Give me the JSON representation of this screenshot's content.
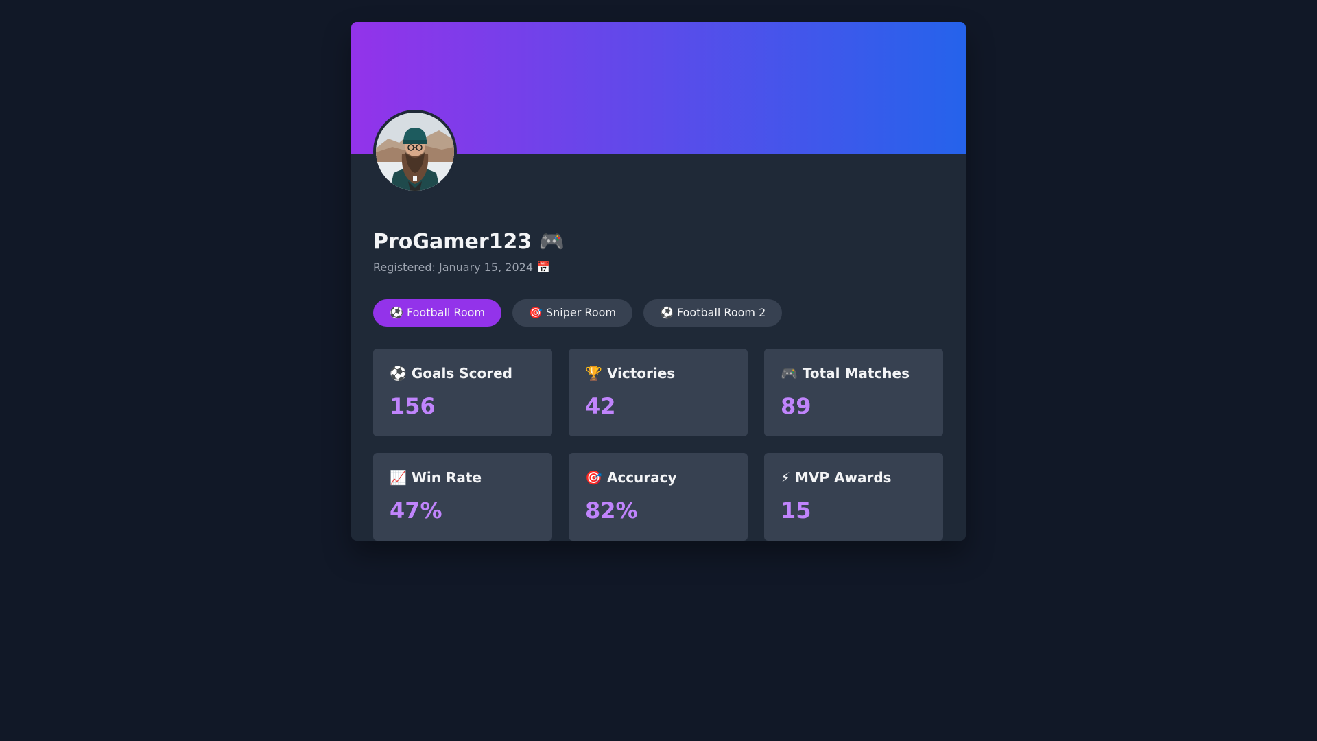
{
  "profile": {
    "username": "ProGamer123 🎮",
    "registered": "Registered: January 15, 2024 📅",
    "avatar_icon": "user-avatar-photo"
  },
  "rooms": [
    {
      "label": "⚽ Football Room",
      "active": true
    },
    {
      "label": "🎯 Sniper Room",
      "active": false
    },
    {
      "label": "⚽ Football Room 2",
      "active": false
    }
  ],
  "stats": [
    {
      "label": "⚽ Goals Scored",
      "value": "156"
    },
    {
      "label": "🏆 Victories",
      "value": "42"
    },
    {
      "label": "🎮 Total Matches",
      "value": "89"
    },
    {
      "label": "📈 Win Rate",
      "value": "47%"
    },
    {
      "label": "🎯 Accuracy",
      "value": "82%"
    },
    {
      "label": "⚡ MVP Awards",
      "value": "15"
    }
  ],
  "colors": {
    "page_background": "#111827",
    "card_background": "#1f2937",
    "banner_gradient_start": "#9333ea",
    "banner_gradient_end": "#2563eb",
    "active_room": "#9333ea",
    "stat_value": "#c084fc"
  }
}
